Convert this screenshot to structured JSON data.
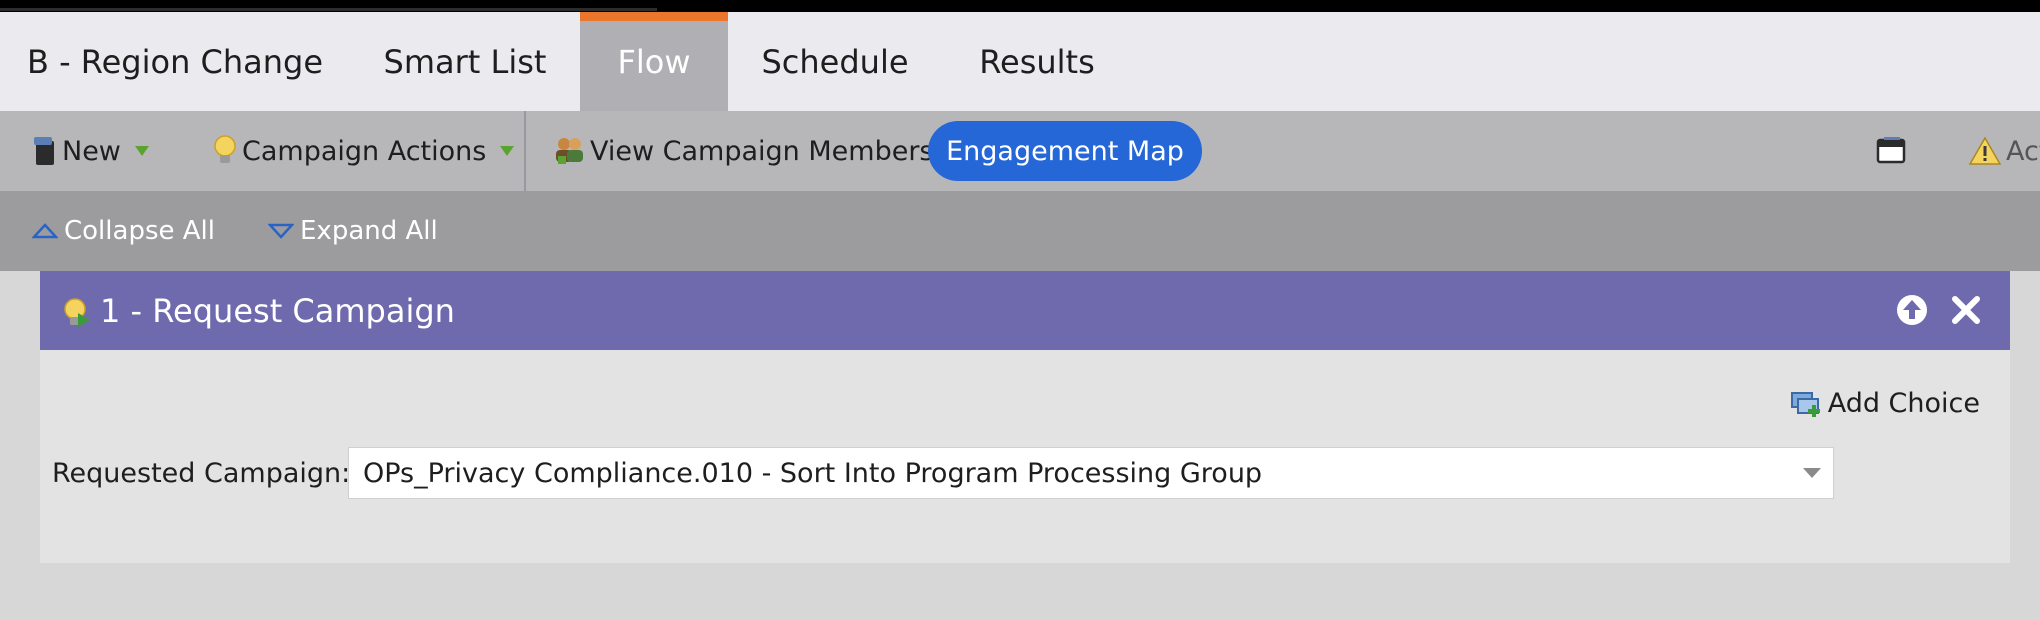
{
  "tabs": [
    {
      "label": "B - Region Change"
    },
    {
      "label": "Smart List"
    },
    {
      "label": "Flow"
    },
    {
      "label": "Schedule"
    },
    {
      "label": "Results"
    }
  ],
  "active_tab": "Flow",
  "toolbar": {
    "new_label": "New",
    "campaign_actions_label": "Campaign Actions",
    "view_members_label": "View Campaign Members",
    "engagement_map_label": "Engagement Map",
    "activate_partial": "Act"
  },
  "secondary": {
    "collapse_label": "Collapse All",
    "expand_label": "Expand All"
  },
  "step": {
    "title": "1 - Request Campaign",
    "add_choice_label": "Add Choice",
    "field_label": "Requested Campaign:",
    "field_value": "OPs_Privacy Compliance.010 - Sort Into Program Processing Group"
  },
  "colors": {
    "active_tab_accent": "#e9762b",
    "engagement_button": "#2567d7",
    "step_header": "#6e6aad"
  }
}
